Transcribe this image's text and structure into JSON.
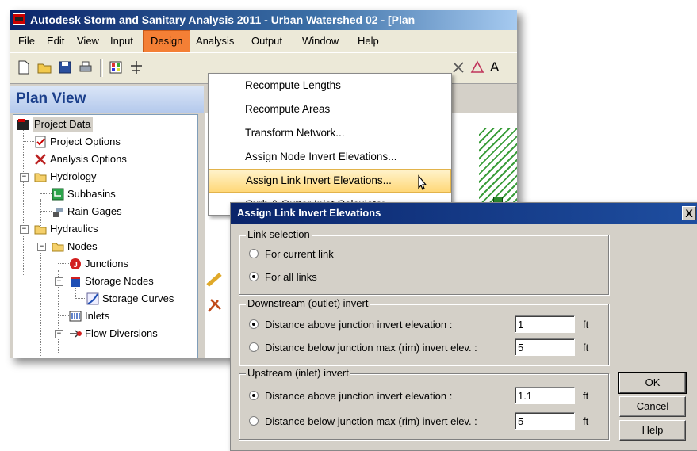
{
  "window": {
    "title": "Autodesk Storm and Sanitary Analysis 2011 - Urban Watershed 02 - [Plan"
  },
  "menubar": {
    "items": [
      {
        "label": "File"
      },
      {
        "label": "Edit"
      },
      {
        "label": "View"
      },
      {
        "label": "Input"
      },
      {
        "label": "Design"
      },
      {
        "label": "Analysis"
      },
      {
        "label": "Output"
      },
      {
        "label": "Window"
      },
      {
        "label": "Help"
      }
    ],
    "active": "Design"
  },
  "plan_view": {
    "title": "Plan View"
  },
  "tree": {
    "items": [
      {
        "label": "Project Data",
        "icon": "project-data-icon"
      },
      {
        "label": "Project Options",
        "icon": "checklist-icon"
      },
      {
        "label": "Analysis Options",
        "icon": "tools-icon"
      },
      {
        "label": "Hydrology",
        "icon": "folder-icon"
      },
      {
        "label": "Subbasins",
        "icon": "subbasin-icon"
      },
      {
        "label": "Rain Gages",
        "icon": "rain-gage-icon"
      },
      {
        "label": "Hydraulics",
        "icon": "folder-icon"
      },
      {
        "label": "Nodes",
        "icon": "folder-icon"
      },
      {
        "label": "Junctions",
        "icon": "junction-icon"
      },
      {
        "label": "Storage Nodes",
        "icon": "storage-node-icon"
      },
      {
        "label": "Storage Curves",
        "icon": "curve-icon"
      },
      {
        "label": "Inlets",
        "icon": "inlet-icon"
      },
      {
        "label": "Flow Diversions",
        "icon": "flow-diversion-icon"
      }
    ]
  },
  "design_menu": {
    "items": [
      {
        "label": "Recompute Lengths"
      },
      {
        "label": "Recompute Areas"
      },
      {
        "label": "Transform Network..."
      },
      {
        "label": "Assign Node Invert Elevations..."
      },
      {
        "label": "Assign Link Invert Elevations..."
      },
      {
        "label": "Curb & Gutter Inlet Calculator..."
      }
    ],
    "highlighted": "Assign Link Invert Elevations..."
  },
  "dialog": {
    "title": "Assign Link Invert Elevations",
    "close_label": "X",
    "link_selection": {
      "label": "Link selection",
      "options": [
        {
          "label": "For current link",
          "checked": false
        },
        {
          "label": "For all links",
          "checked": true
        }
      ]
    },
    "downstream": {
      "label": "Downstream (outlet) invert",
      "options": [
        {
          "label": "Distance above junction invert elevation :",
          "checked": true,
          "value": "1",
          "unit": "ft"
        },
        {
          "label": "Distance below junction max (rim) invert elev. :",
          "checked": false,
          "value": "5",
          "unit": "ft"
        }
      ]
    },
    "upstream": {
      "label": "Upstream (inlet) invert",
      "options": [
        {
          "label": "Distance above junction invert elevation :",
          "checked": true,
          "value": "1.1",
          "unit": "ft"
        },
        {
          "label": "Distance below junction max (rim) invert elev. :",
          "checked": false,
          "value": "5",
          "unit": "ft"
        }
      ]
    },
    "buttons": {
      "ok": "OK",
      "cancel": "Cancel",
      "help": "Help"
    }
  },
  "colors": {
    "title_bar": "#0a246a",
    "active_menu": "#f47f35",
    "highlight": "#ffd878",
    "plan_view_text": "#1b3f8b"
  }
}
